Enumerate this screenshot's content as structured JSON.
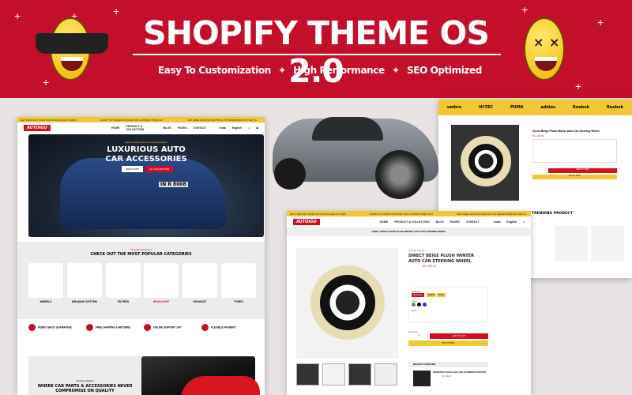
{
  "banner": {
    "title": "SHOPIFY THEME  OS 2.0",
    "features": [
      "Easy To Customization",
      "High Performance",
      "SEO Optimized"
    ],
    "bg_color": "#c40f2b"
  },
  "store": {
    "logo": "AUTOIGO",
    "ticker": [
      "GET A $50 GIFT CARD ON A PURCHASE OF $1000",
      "HURRY UP OFFER RUNNING FOR A LIMITED TIME ONLY",
      "GET FREE GROUND SHIPPING ON ORDERS $500 IN THE U.S.",
      "HURRY UP OFFER RUNNING FOR A LIMITED TIME ONLY"
    ],
    "nav": [
      "HOME",
      "PRODUCT & COLLECTION",
      "BLOG",
      "PAGES",
      "CONTACT"
    ],
    "currency": "India",
    "language": "English"
  },
  "home": {
    "hero_kicker": "Enjoy an entirely new level of driving experience",
    "hero_title": "LUXURIOUS AUTO CAR ACCESSORIES",
    "hero_buttons": [
      "SHOP NOW",
      "ALL COLLECTION"
    ],
    "plate": "IN R 8008",
    "cat_kicker": "Shop By Categories",
    "cat_title": "CHECK OUT THE MOST POPULAR CATEGORIES",
    "categories": [
      "WHEELS",
      "BRAKING SYSTEM",
      "FILTERS",
      "HEADLIGHT",
      "EXHAUST",
      "TYRES"
    ],
    "features": [
      "MONEY BACK GUARANTEE",
      "FREE SHIPPING & RETURNS",
      "ONLINE SUPPORT 24/7",
      "FLEXIBLE PAYMENT"
    ],
    "promo_kicker": "Shop By Categories",
    "promo_title": "WHERE CAR PARTS & ACCESSORIES NEVER COMPROMISE ON QUALITY"
  },
  "product": {
    "breadcrumb": "HOME / DIRECT BEIGE PLUSH WINTER AUTO CAR STEERING WHEEL",
    "vendor": "Autoigo Theme",
    "title": "DIRECT BEIGE PLUSH WINTER AUTO CAR STEERING WHEEL",
    "price": "Rs. 120.00",
    "material_label": "Material",
    "materials": [
      "Aluminium",
      "Rubber",
      "Plastic"
    ],
    "color_label": "Color",
    "size_label": "Size",
    "quantity_label": "Quantity",
    "quantity": "1",
    "add_to_cart": "ADD TO CART",
    "buy_now": "BUY IT NOW",
    "bought_together": "BOUGHT TOGETHER",
    "bundle_item": "EVERSTART VALUE LEAD ACID AUTOMOTIVE BATTERY",
    "bundle_price": "Rs. 49.00"
  },
  "product_alt": {
    "title": "Direct Beige Plush Winter Auto Car Steering Wheel",
    "price": "Rs. 120.00",
    "add_to_cart": "ADD TO CART",
    "buy_now": "BUY IT NOW",
    "brands": [
      "umbro",
      "HI-TEC",
      "PUMA",
      "adidas",
      "Reebok",
      "Reebok"
    ],
    "section_title": "TRENDING PRODUCT"
  }
}
